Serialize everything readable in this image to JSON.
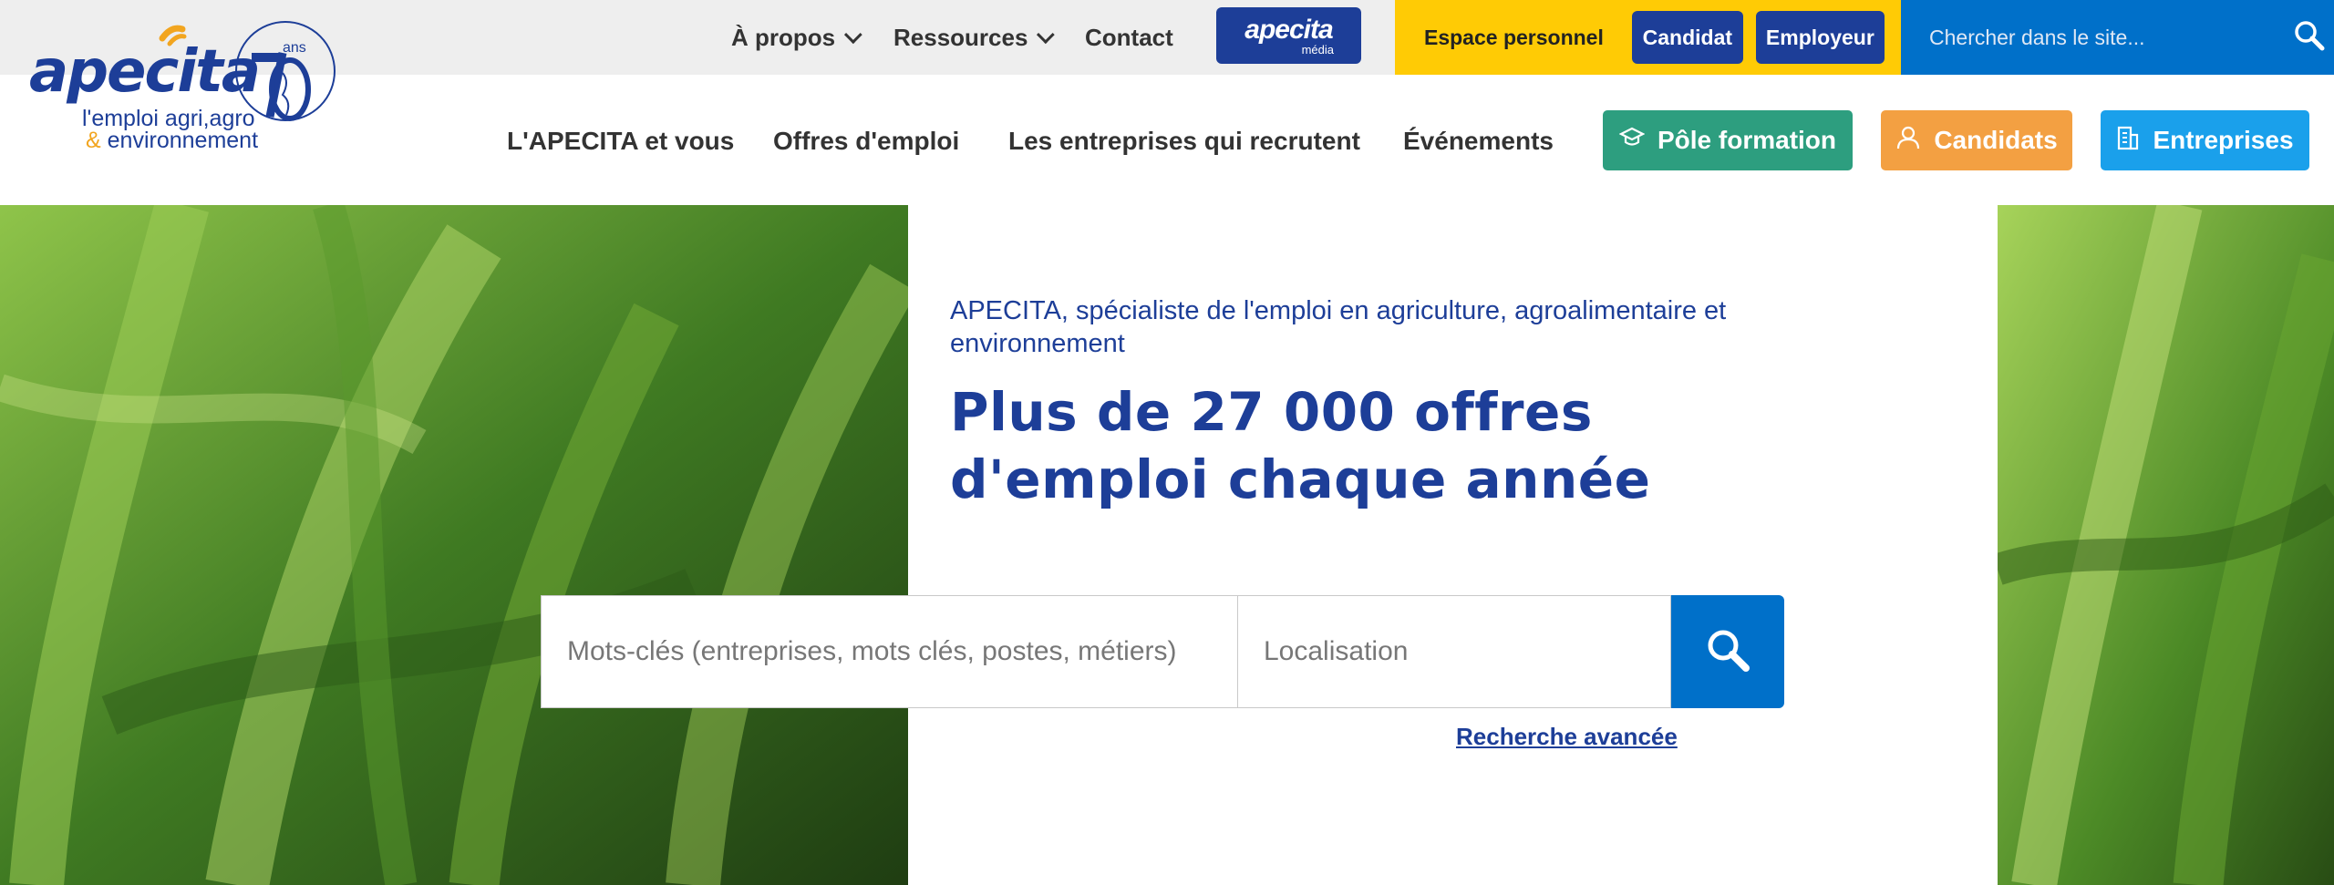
{
  "topbar": {
    "nav": [
      {
        "label": "À propos",
        "has_dropdown": true
      },
      {
        "label": "Ressources",
        "has_dropdown": true
      },
      {
        "label": "Contact",
        "has_dropdown": false
      }
    ],
    "media_button": {
      "brand": "apecita",
      "sub": "média"
    },
    "personal": {
      "label": "Espace personnel",
      "candidate": "Candidat",
      "employer": "Employeur"
    },
    "search": {
      "placeholder": "Chercher dans le site..."
    }
  },
  "logo": {
    "brand": "apecita",
    "line1": "l'emploi agri,agro",
    "amp": "&",
    "line2": "environnement",
    "badge_number": "70",
    "badge_unit": "ans"
  },
  "mainnav": {
    "links": [
      "L'APECITA et vous",
      "Offres d'emploi",
      "Les entreprises qui recrutent",
      "Événements"
    ],
    "pole_formation": "Pôle formation",
    "candidats": "Candidats",
    "entreprises": "Entreprises"
  },
  "hero": {
    "subtitle": "APECITA, spécialiste de l'emploi en agriculture, agroalimentaire et environnement",
    "headline": "Plus de 27 000 offres d'emploi chaque année",
    "keywords_placeholder": "Mots-clés (entreprises, mots clés, postes, métiers)",
    "location_placeholder": "Localisation",
    "advanced_search": "Recherche avancée"
  },
  "icons": {
    "chevron": "chevron-down-icon",
    "search": "search-icon",
    "graduation": "graduation-cap-icon",
    "user": "user-icon",
    "building": "building-icon"
  },
  "colors": {
    "navy": "#1d3e98",
    "blue": "#0070c9",
    "yellow": "#ffcb05",
    "green": "#2d9e7f",
    "orange": "#f3a042",
    "cyan": "#1aa0eb",
    "logo_orange": "#f2a51f"
  }
}
